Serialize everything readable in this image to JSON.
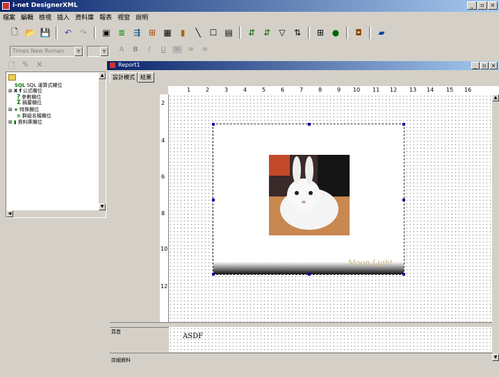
{
  "app": {
    "title": "i-net DesignerXML",
    "win_min": "_",
    "win_max": "▫",
    "win_close": "×"
  },
  "menu": [
    "檔案",
    "編輯",
    "檢視",
    "插入",
    "資料庫",
    "報表",
    "視窗",
    "說明"
  ],
  "format_toolbar": {
    "font_value": "Times New Roman",
    "size_value": "",
    "buttons": [
      "A",
      "B",
      "I",
      "U"
    ],
    "align": [
      "≡",
      "≡",
      "≡"
    ]
  },
  "field_explorer": {
    "items": [
      {
        "label": "SQL 運算式欄位",
        "icon": "SQL",
        "expander": ""
      },
      {
        "label": "公式欄位",
        "icon": "X f",
        "expander": "⊞"
      },
      {
        "label": "參數欄位",
        "icon": "?",
        "expander": ""
      },
      {
        "label": "摘要欄位",
        "icon": "Σ",
        "expander": ""
      },
      {
        "label": "特殊欄位",
        "icon": "★",
        "expander": "⊞"
      },
      {
        "label": "群組名稱欄位",
        "icon": "≡",
        "expander": ""
      },
      {
        "label": "資料庫欄位",
        "icon": "▮",
        "expander": "⊞"
      }
    ]
  },
  "report": {
    "title": "Report1",
    "tabs": [
      "設計模式",
      "結果"
    ],
    "ruler_h": [
      "1",
      "2",
      "3",
      "4",
      "5",
      "6",
      "7",
      "8",
      "9",
      "10",
      "11",
      "12",
      "13",
      "14",
      "15",
      "16"
    ],
    "ruler_v": [
      "2",
      "4",
      "6",
      "8",
      "10",
      "12"
    ],
    "bands": [
      {
        "label": "頁首"
      },
      {
        "label": "詳細資料"
      }
    ],
    "header_text": "ASDF",
    "image_caption": "Moon Light"
  },
  "colors": {
    "titlebar": "#0a246a",
    "background": "#d4d0c8"
  }
}
